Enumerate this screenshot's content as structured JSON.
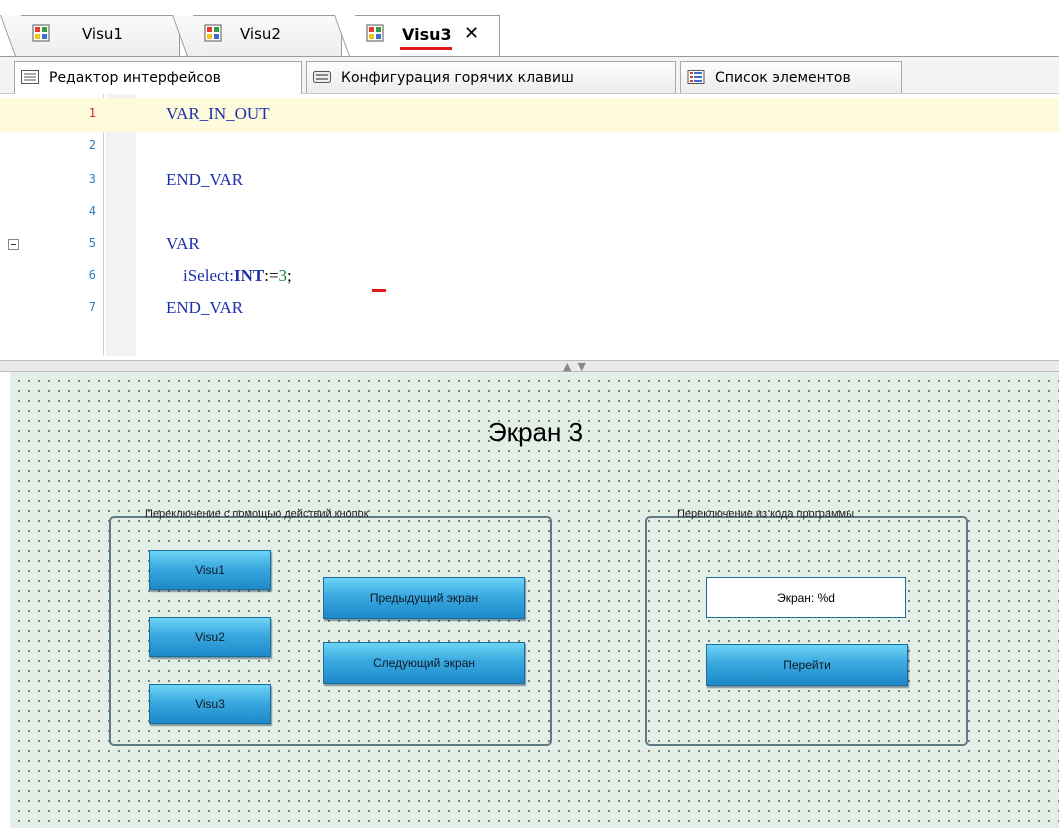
{
  "doc_tabs": [
    {
      "label": "Visu1",
      "active": false
    },
    {
      "label": "Visu2",
      "active": false
    },
    {
      "label": "Visu3",
      "active": true
    }
  ],
  "sub_tabs": [
    {
      "label": "Редактор интерфейсов",
      "active": true
    },
    {
      "label": "Конфигурация горячих клавиш",
      "active": false
    },
    {
      "label": "Список элементов",
      "active": false
    }
  ],
  "code_lines": [
    {
      "num": "1",
      "text": "VAR_IN_OUT"
    },
    {
      "num": "2",
      "text": ""
    },
    {
      "num": "3",
      "text": "END_VAR"
    },
    {
      "num": "4",
      "text": ""
    },
    {
      "num": "5",
      "text": "VAR"
    },
    {
      "num": "6",
      "text_prefix": "    iSelect:",
      "text_type": "INT",
      "text_assign": ":=",
      "text_value": "3",
      "text_end": ";"
    },
    {
      "num": "7",
      "text": "END_VAR"
    }
  ],
  "visu": {
    "title": "Экран 3",
    "group_left": {
      "label": "Переключение с помощью действий кнопок",
      "buttons": [
        "Visu1",
        "Visu2",
        "Visu3"
      ],
      "prev_button": "Предыдущий экран",
      "next_button": "Следующий экран"
    },
    "group_right": {
      "label": "Переключение из кода программы",
      "screen_field": "Экран: %d",
      "go_button": "Перейти"
    }
  },
  "colors": {
    "accent_red": "#e01818",
    "canvas_bg": "#e3efe6",
    "button_blue": "#3aa9e0",
    "line_highlight": "#fefbdc"
  }
}
